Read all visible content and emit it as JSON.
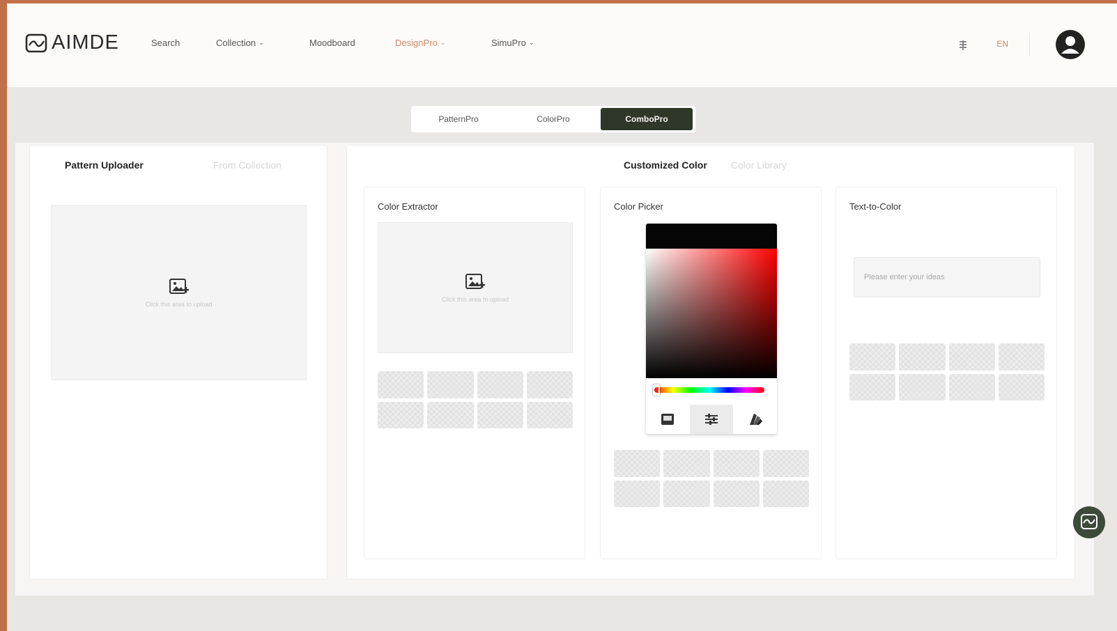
{
  "header": {
    "logo_text": "AIMDE",
    "nav": [
      {
        "label": "Search",
        "has_caret": false,
        "active": false
      },
      {
        "label": "Collection",
        "has_caret": true,
        "active": false
      },
      {
        "label": "Moodboard",
        "has_caret": false,
        "active": false
      },
      {
        "label": "DesignPro",
        "has_caret": true,
        "active": true
      },
      {
        "label": "SimuPro",
        "has_caret": true,
        "active": false
      }
    ],
    "caret": "⌄",
    "lang": "EN"
  },
  "mode_tabs": [
    "PatternPro",
    "ColorPro",
    "ComboPro"
  ],
  "mode_tab_active": "ComboPro",
  "left_panel": {
    "tabs": [
      "Pattern Uploader",
      "From Collection"
    ],
    "active_tab": "Pattern Uploader",
    "upload_hint": "Click this area to upload"
  },
  "right_panel": {
    "tabs": [
      "Customized Color",
      "Color Library"
    ],
    "active_tab": "Customized Color",
    "color_extractor": {
      "title": "Color Extractor",
      "upload_hint": "Click this area to upload"
    },
    "color_picker": {
      "title": "Color Picker",
      "hue_position": 0.02,
      "modes": [
        "palette-icon",
        "sliders-icon",
        "swatches-icon"
      ],
      "active_mode": "sliders-icon"
    },
    "text_to_color": {
      "title": "Text-to-Color",
      "input_placeholder": "Please enter your ideas",
      "input_value": ""
    }
  },
  "colors": {
    "accent": "#c98a6a",
    "dark": "#2f3729",
    "outer": "#c0714a"
  }
}
